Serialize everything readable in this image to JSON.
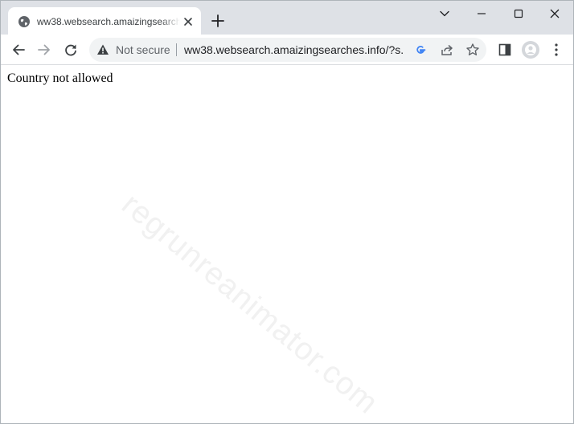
{
  "tab": {
    "title": "ww38.websearch.amaizingsearches.info",
    "favicon": "globe-icon"
  },
  "toolbar": {
    "security_label": "Not secure",
    "url": "ww38.websearch.amaizingsearches.info/?s..."
  },
  "page": {
    "message": "Country not allowed",
    "watermark": "regrunreanimator.com"
  },
  "icons": {
    "back": "back-arrow-icon",
    "forward": "forward-arrow-icon",
    "reload": "reload-icon",
    "warning": "warning-icon",
    "google": "google-icon",
    "share": "share-icon",
    "bookmark": "star-icon",
    "side_panel": "side-panel-icon",
    "profile": "profile-avatar-icon",
    "menu": "kebab-menu-icon"
  },
  "colors": {
    "tabstrip_bg": "#dee1e6",
    "omnibox_bg": "#f1f3f4",
    "google_blue": "#4285f4"
  }
}
